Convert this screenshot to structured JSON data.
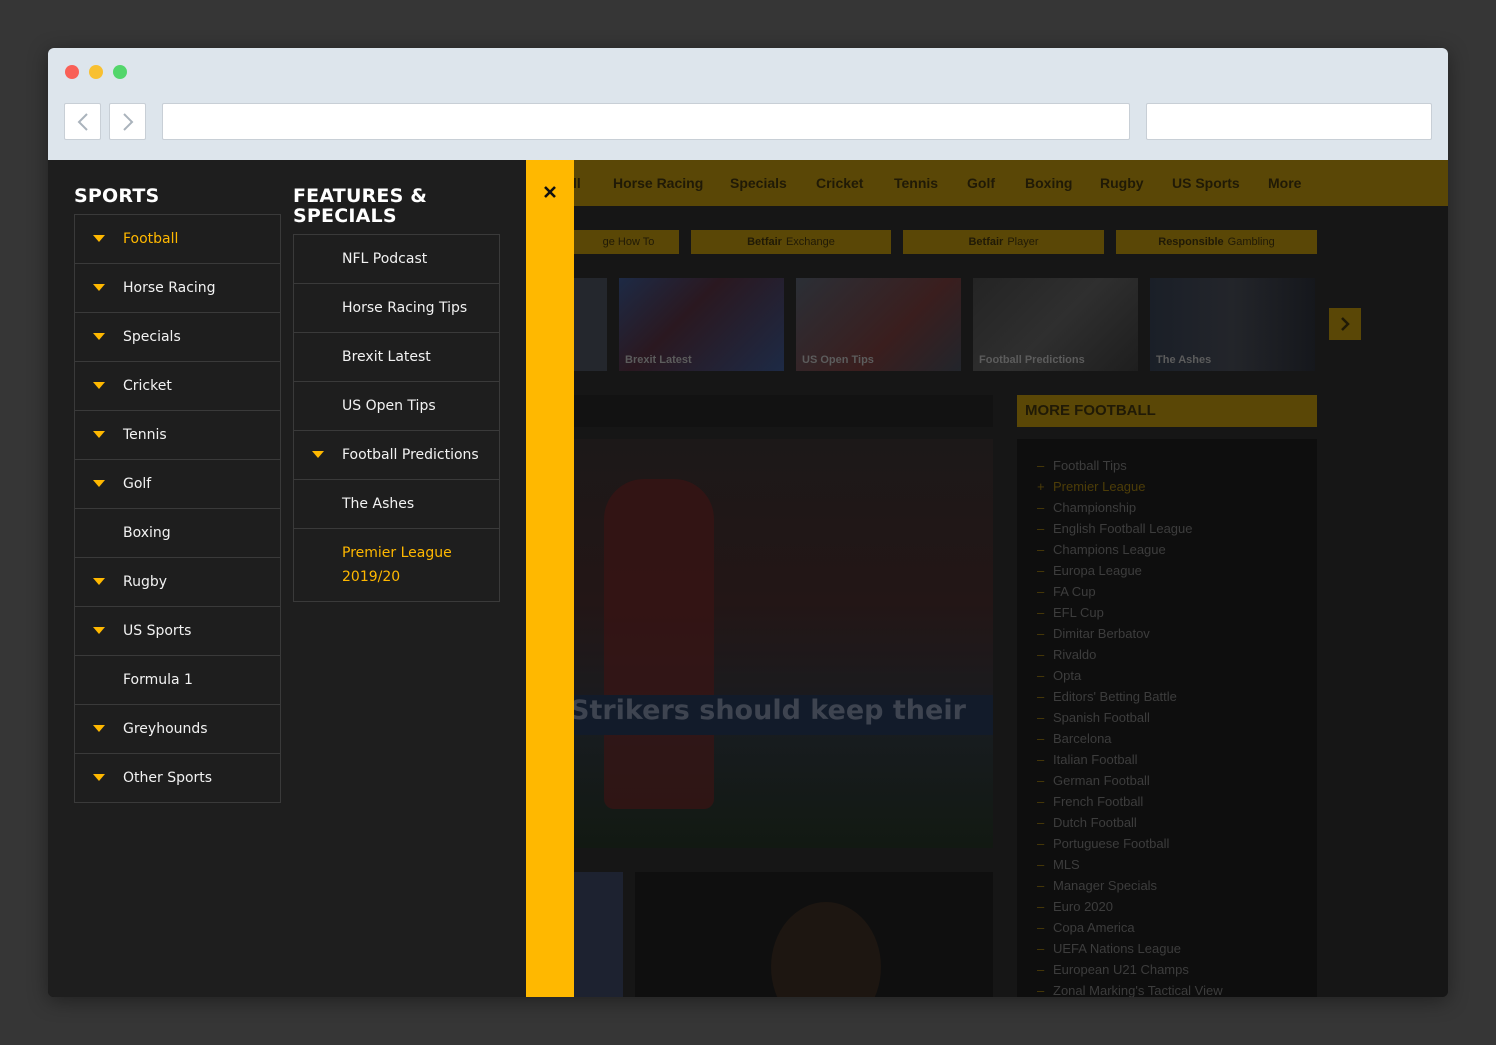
{
  "background_page": {
    "top_nav": [
      "ll",
      "Horse Racing",
      "Specials",
      "Cricket",
      "Tennis",
      "Golf",
      "Boxing",
      "Rugby",
      "US Sports",
      "More"
    ],
    "sub_nav": [
      {
        "bold": "",
        "text": "ge How To"
      },
      {
        "bold": "Betfair",
        "text": "Exchange"
      },
      {
        "bold": "Betfair",
        "text": "Player"
      },
      {
        "bold": "Responsible",
        "text": "Gambling"
      }
    ],
    "thumbnails": [
      "Brexit Latest",
      "US Open Tips",
      "Football Predictions",
      "The Ashes"
    ],
    "hero_headline": "Strikers should keep their",
    "more_football": {
      "title": "MORE FOOTBALL",
      "items": [
        "Football Tips",
        "Premier League",
        "Championship",
        "English Football League",
        "Champions League",
        "Europa League",
        "FA Cup",
        "EFL Cup",
        "Dimitar Berbatov",
        "Rivaldo",
        "Opta",
        "Editors' Betting Battle",
        "Spanish Football",
        "Barcelona",
        "Italian Football",
        "German Football",
        "French Football",
        "Dutch Football",
        "Portuguese Football",
        "MLS",
        "Manager Specials",
        "Euro 2020",
        "Copa America",
        "UEFA Nations League",
        "European U21 Champs",
        "Zonal Marking's Tactical View"
      ],
      "active_index": 1
    }
  },
  "menu": {
    "sports_title": "SPORTS",
    "features_title_line1": "FEATURES &",
    "features_title_line2": "SPECIALS",
    "sports": [
      {
        "label": "Football",
        "caret": true,
        "active": true
      },
      {
        "label": "Horse Racing",
        "caret": true
      },
      {
        "label": "Specials",
        "caret": true
      },
      {
        "label": "Cricket",
        "caret": true
      },
      {
        "label": "Tennis",
        "caret": true
      },
      {
        "label": "Golf",
        "caret": true
      },
      {
        "label": "Boxing",
        "caret": false
      },
      {
        "label": "Rugby",
        "caret": true
      },
      {
        "label": "US Sports",
        "caret": true
      },
      {
        "label": "Formula 1",
        "caret": false
      },
      {
        "label": "Greyhounds",
        "caret": true
      },
      {
        "label": "Other Sports",
        "caret": true
      }
    ],
    "features": [
      {
        "label": "NFL Podcast",
        "caret": false
      },
      {
        "label": "Horse Racing Tips",
        "caret": false
      },
      {
        "label": "Brexit Latest",
        "caret": false
      },
      {
        "label": "US Open Tips",
        "caret": false
      },
      {
        "label": "Football Predictions",
        "caret": true
      },
      {
        "label": "The Ashes",
        "caret": false
      },
      {
        "label": "Premier League 2019/20",
        "line1": "Premier League",
        "line2": "2019/20",
        "caret": false,
        "active": true
      }
    ]
  },
  "colors": {
    "accent": "#ffb800",
    "panel_bg": "#1e1e1e",
    "chrome_bg": "#dde5ec"
  },
  "icons": {
    "close": "close-icon",
    "back": "chevron-left-icon",
    "forward": "chevron-right-icon",
    "caret": "caret-down-icon"
  }
}
